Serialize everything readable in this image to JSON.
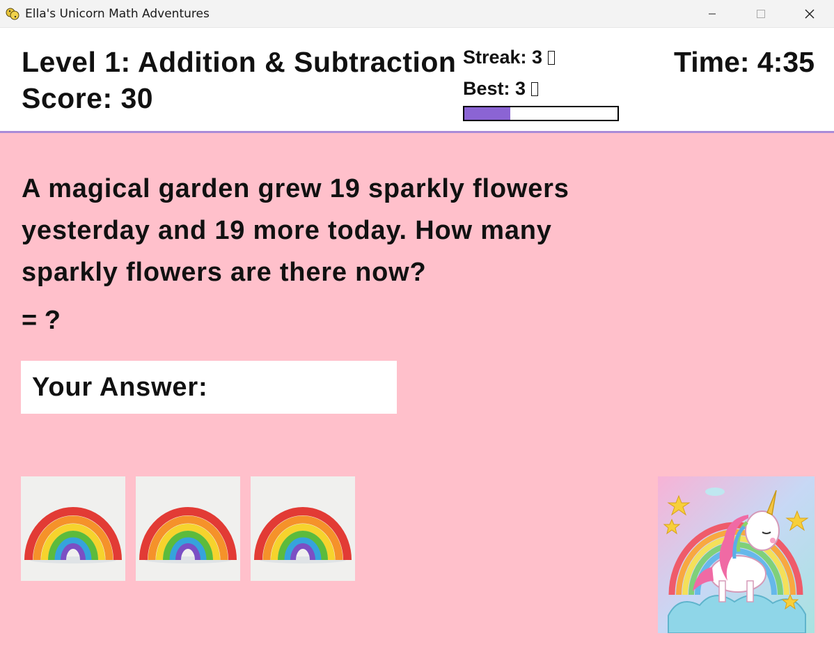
{
  "window": {
    "title": "Ella's Unicorn Math Adventures"
  },
  "header": {
    "level_title": "Level 1: Addition & Subtraction",
    "score": "Score: 30",
    "streak": "Streak: 3",
    "best": "Best: 3",
    "streak_progress_fraction": 0.3,
    "time": "Time: 4:35"
  },
  "problem": {
    "question": "A magical garden grew 19 sparkly flowers yesterday and 19 more today. How many sparkly flowers are there now?",
    "equation": "= ?"
  },
  "answer": {
    "label": "Your Answer:",
    "value": ""
  },
  "rewards": {
    "items": [
      "rainbow-icon",
      "rainbow-icon",
      "rainbow-icon"
    ]
  },
  "mascot": {
    "icon": "unicorn-icon"
  },
  "colors": {
    "main_background": "#ffc0cb",
    "accent": "#8b64d4",
    "header_border": "#a98bd8"
  }
}
